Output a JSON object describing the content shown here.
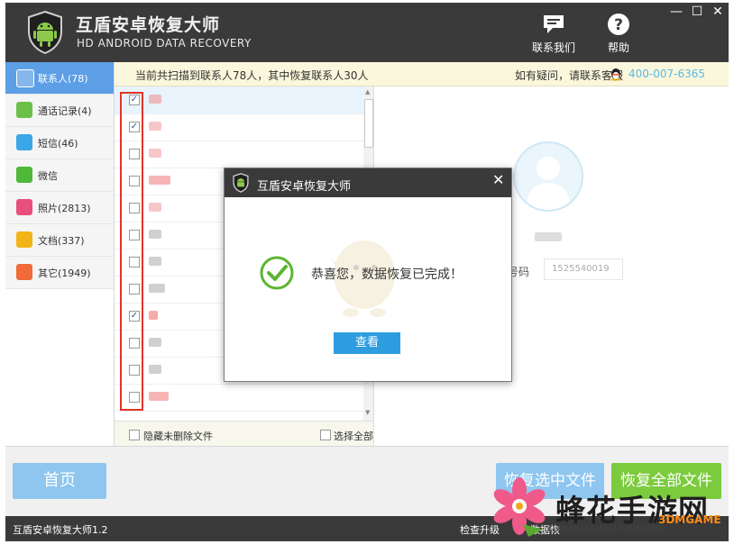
{
  "app": {
    "title": "互盾安卓恢复大师",
    "subtitle": "HD ANDROID DATA RECOVERY",
    "toolbar": {
      "contact_label": "联系我们",
      "help_label": "帮助"
    },
    "window_controls": {
      "minimize": "—",
      "maximize": "☐",
      "close": "✕"
    }
  },
  "infobar": {
    "scan_summary": "当前共扫描到联系人78人，其中恢复联系人30人",
    "help_text": "如有疑问，请联系客服",
    "phone": "400-007-6365"
  },
  "sidebar": {
    "items": [
      {
        "label": "联系人(78)",
        "icon": "contacts-icon",
        "color": "#ffffff",
        "active": true
      },
      {
        "label": "通话记录(4)",
        "icon": "call-log-icon",
        "color": "#6cc04a",
        "active": false
      },
      {
        "label": "短信(46)",
        "icon": "sms-icon",
        "color": "#3aa6e8",
        "active": false
      },
      {
        "label": "微信",
        "icon": "wechat-icon",
        "color": "#4fb839",
        "active": false
      },
      {
        "label": "照片(2813)",
        "icon": "photo-icon",
        "color": "#e8507c",
        "active": false
      },
      {
        "label": "文档(337)",
        "icon": "document-icon",
        "color": "#f2b418",
        "active": false
      },
      {
        "label": "其它(1949)",
        "icon": "other-icon",
        "color": "#f06a3a",
        "active": false
      }
    ]
  },
  "filelist": {
    "rows": [
      {
        "checked": true,
        "blur_color": "#e88",
        "blur_width": 14,
        "selected": true
      },
      {
        "checked": true,
        "blur_color": "#e99",
        "blur_width": 14,
        "selected": false
      },
      {
        "checked": false,
        "blur_color": "#e99",
        "blur_width": 14,
        "selected": false
      },
      {
        "checked": false,
        "blur_color": "#e77",
        "blur_width": 24,
        "selected": false
      },
      {
        "checked": false,
        "blur_color": "#e99",
        "blur_width": 14,
        "selected": false
      },
      {
        "checked": false,
        "blur_color": "#aaa",
        "blur_width": 14,
        "selected": false
      },
      {
        "checked": false,
        "blur_color": "#aaa",
        "blur_width": 14,
        "selected": false
      },
      {
        "checked": false,
        "blur_color": "#aaa",
        "blur_width": 18,
        "selected": false
      },
      {
        "checked": true,
        "blur_color": "#e66",
        "blur_width": 10,
        "selected": false
      },
      {
        "checked": false,
        "blur_color": "#aaa",
        "blur_width": 14,
        "selected": false
      },
      {
        "checked": false,
        "blur_color": "#aaa",
        "blur_width": 14,
        "selected": false
      },
      {
        "checked": false,
        "blur_color": "#e77",
        "blur_width": 22,
        "selected": false
      }
    ],
    "hide_undeleted_label": "隐藏未删除文件",
    "select_all_label": "选择全部"
  },
  "detail": {
    "phone_label": "号码",
    "phone_value": "1525540019"
  },
  "dialog": {
    "title": "互盾安卓恢复大师",
    "close": "✕",
    "message": "恭喜您，数据恢复已完成！",
    "view_button": "查看"
  },
  "bottom": {
    "home_button": "首页",
    "recover_selected_button": "恢复选中文件",
    "recover_all_button": "恢复全部文件"
  },
  "statusbar": {
    "version": "互盾安卓恢复大师1.2",
    "check_upgrade": "检查升级",
    "data_text": "数据恢"
  },
  "watermark": {
    "text": "蜂花手游网",
    "pinyin": "XIANHUASHOUYOUWANG",
    "domain": "3DMGAME"
  },
  "colors": {
    "titlebar": "#3a3a3a",
    "accent_blue": "#2d9de0",
    "success_green": "#6cc04a",
    "highlight_red": "#e2332a"
  }
}
